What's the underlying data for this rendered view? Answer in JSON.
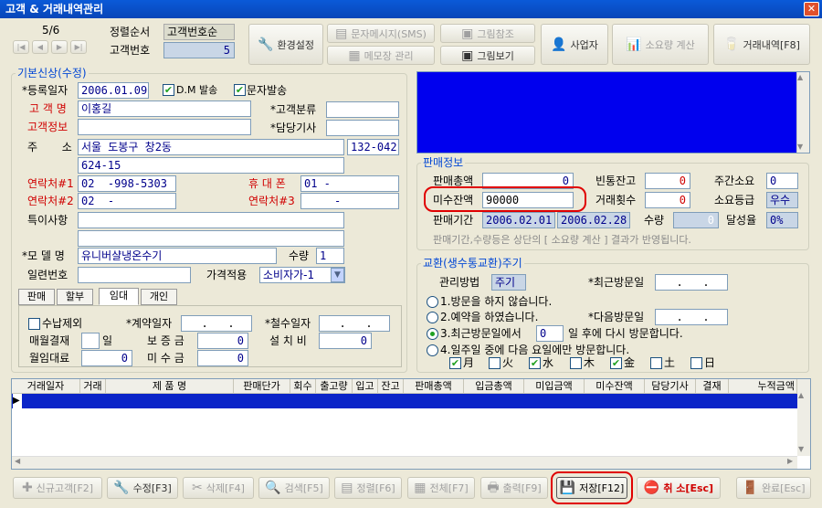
{
  "window": {
    "title": "고객 & 거래내역관리",
    "close": "✕"
  },
  "nav": {
    "counter": "5/6",
    "buttons": [
      "|◀",
      "◀",
      "▶",
      "▶|"
    ]
  },
  "sort": {
    "label": "정렬순서",
    "value": "고객번호순",
    "id_label": "고객번호",
    "id_value": "5"
  },
  "toolbar": {
    "env": "환경설정",
    "sms": "문자메시지(SMS)",
    "memo": "메모장 관리",
    "pic_ref": "그림참조",
    "pic_view": "그림보기",
    "business": "사업자",
    "usage": "소요량 계산",
    "history": "거래내역[F8]"
  },
  "basic": {
    "legend": "기본신상(수정)",
    "reg_date_label": "*등록일자",
    "reg_date": "2006.01.09",
    "dm_label": "D.M 발송",
    "sms_label": "문자발송",
    "name_label": "고 객 명",
    "name": "이홍길",
    "class_label": "*고객분류",
    "class": "",
    "info_label": "고객정보",
    "info": "",
    "tech_label": "*담당기사",
    "tech": "",
    "addr_label": "주       소",
    "addr1": "서울 도봉구 창2동",
    "zip": "132-042",
    "addr2": "624-15",
    "tel1_label": "연락처#1",
    "tel1": "02  -998-5303",
    "mobile_label": "휴 대 폰",
    "mobile": "01 -",
    "tel2_label": "연락처#2",
    "tel2": "02  -",
    "tel3_label": "연락처#3",
    "tel3": "-",
    "notes_label": "특이사항",
    "model_label": "*모 델 명",
    "model": "유니버샬냉온수기",
    "qty_label": "수량",
    "qty": "1",
    "serial_label": "일련번호",
    "serial": "",
    "price_label": "가격적용",
    "price": "소비자가-1"
  },
  "tabs": [
    "판매",
    "할부",
    "임대",
    "개인"
  ],
  "lease": {
    "exclude_label": "수납제외",
    "contract_label": "*계약일자",
    "contract": ".   .",
    "withdraw_label": "*철수일자",
    "withdraw": ".   .",
    "monthly_label": "매월결재",
    "day_label": "일",
    "deposit_label": "보 증 금",
    "deposit": "0",
    "install_label": "설 치 비",
    "install": "0",
    "rent_label": "월임대료",
    "rent": "0",
    "unpaid_label": "미 수 금",
    "unpaid": "0"
  },
  "sales": {
    "legend": "판매정보",
    "total_label": "판매총액",
    "total": "0",
    "bottles_label": "빈통잔고",
    "bottles": "0",
    "cycle_label": "주간소요",
    "cycle": "0",
    "balance_label": "미수잔액",
    "balance": "90000",
    "count_label": "거래횟수",
    "count": "0",
    "grade_label": "소요등급",
    "grade": "우수",
    "period_label": "판매기간",
    "period_from": "2006.02.01",
    "period_to": "2006.02.28",
    "amount_label": "수량",
    "amount": "0",
    "rate_label": "달성율",
    "rate": "0%",
    "note": "판매기간,수량등은 상단의 [ 소요량 계산 ] 결과가 반영됩니다."
  },
  "exchange": {
    "legend": "교환(생수통교환)주기",
    "method_label": "관리방법",
    "method": "주기",
    "last_label": "*최근방문일",
    "last": ".   .",
    "next_label": "*다음방문일",
    "next": ".   .",
    "opt1": "1.방문을 하지 않습니다.",
    "opt2": "2.예약을 하였습니다.",
    "opt3a": "3.최근방문일에서",
    "opt3_days": "0",
    "opt3b": "일 후에 다시 방문합니다.",
    "opt4": "4.일주일 중에 다음 요일에만 방문합니다.",
    "days": [
      {
        "label": "月",
        "checked": true
      },
      {
        "label": "火",
        "checked": false
      },
      {
        "label": "水",
        "checked": true
      },
      {
        "label": "木",
        "checked": false
      },
      {
        "label": "金",
        "checked": true
      },
      {
        "label": "土",
        "checked": false
      },
      {
        "label": "日",
        "checked": false
      }
    ]
  },
  "table": {
    "columns": [
      "거래일자",
      "거래",
      "제   품   명",
      "판매단가",
      "회수",
      "출고량",
      "입고",
      "잔고",
      "판매총액",
      "입금총액",
      "미입금액",
      "미수잔액",
      "담당기사",
      "결재",
      "누적금액"
    ]
  },
  "bottom": {
    "new": "신규고객[F2]",
    "edit": "수정[F3]",
    "delete": "삭제[F4]",
    "search": "검색[F5]",
    "sort": "정렬[F6]",
    "all": "전체[F7]",
    "print": "출력[F9]",
    "save": "저장[F12]",
    "cancel": "취 소[Esc]",
    "done": "완료[Esc]"
  },
  "colors": {
    "highlight": "#e00000",
    "blue_panel": "#0000ee",
    "label_blue": "#0046d5"
  }
}
